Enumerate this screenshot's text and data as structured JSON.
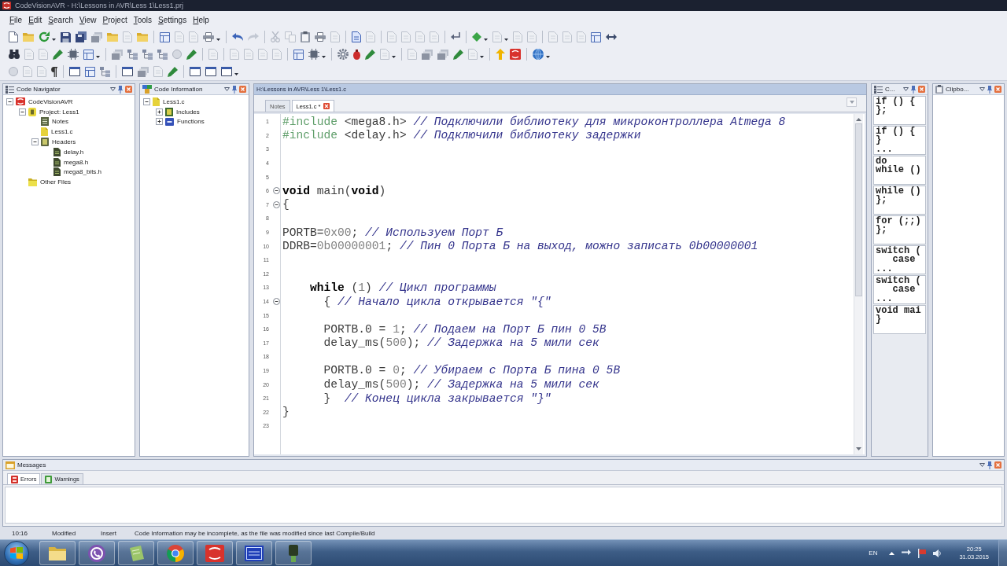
{
  "window": {
    "title": "CodeVisionAVR - H:\\Lessons in AVR\\Less 1\\Less1.prj"
  },
  "menu": [
    "File",
    "Edit",
    "Search",
    "View",
    "Project",
    "Tools",
    "Settings",
    "Help"
  ],
  "code_navigator": {
    "title": "Code Navigator",
    "tree": [
      {
        "label": "CodeVisionAVR",
        "kind": "workspace",
        "expanded": true,
        "children": [
          {
            "label": "Project: Less1",
            "kind": "project",
            "expanded": true,
            "children": [
              {
                "label": "Notes",
                "kind": "notes"
              },
              {
                "label": "Less1.c",
                "kind": "source"
              },
              {
                "label": "Headers",
                "kind": "headers",
                "expanded": true,
                "children": [
                  {
                    "label": "delay.h",
                    "kind": "header"
                  },
                  {
                    "label": "mega8.h",
                    "kind": "header"
                  },
                  {
                    "label": "mega8_bits.h",
                    "kind": "header"
                  }
                ]
              }
            ]
          },
          {
            "label": "Other Files",
            "kind": "folder"
          }
        ]
      }
    ]
  },
  "code_information": {
    "title": "Code Information",
    "tree": [
      {
        "label": "Less1.c",
        "kind": "source",
        "expanded": true,
        "children": [
          {
            "label": "Includes",
            "kind": "includes",
            "expanded": false
          },
          {
            "label": "Functions",
            "kind": "functions",
            "expanded": false
          }
        ]
      }
    ]
  },
  "editor": {
    "path": "H:\\Lessons in AVR\\Less 1\\Less1.c",
    "tabs": [
      {
        "label": "Notes",
        "selected": false,
        "closable": false
      },
      {
        "label": "Less1.c *",
        "selected": true,
        "closable": true
      }
    ],
    "lines": [
      {
        "number": "1",
        "fold": false,
        "segments": [
          {
            "kind": "directive",
            "text": "#include"
          },
          {
            "kind": "plain",
            "text": " <mega8.h> "
          },
          {
            "kind": "comment",
            "text": "// Подключили библиотеку для микроконтроллера Atmega 8"
          }
        ]
      },
      {
        "number": "2",
        "fold": false,
        "segments": [
          {
            "kind": "directive",
            "text": "#include"
          },
          {
            "kind": "plain",
            "text": " <delay.h> "
          },
          {
            "kind": "comment",
            "text": "// Подключили библиотеку задержки"
          }
        ]
      },
      {
        "number": "3",
        "fold": false
      },
      {
        "number": "4",
        "fold": false
      },
      {
        "number": "5",
        "fold": false
      },
      {
        "number": "6",
        "fold": true,
        "segments": [
          {
            "kind": "keyword",
            "text": "void"
          },
          {
            "kind": "plain",
            "text": " main("
          },
          {
            "kind": "keyword",
            "text": "void"
          },
          {
            "kind": "plain",
            "text": ")"
          }
        ]
      },
      {
        "number": "7",
        "fold": true,
        "segments": [
          {
            "kind": "plain",
            "text": "{"
          }
        ]
      },
      {
        "number": "8",
        "fold": false
      },
      {
        "number": "9",
        "fold": false,
        "segments": [
          {
            "kind": "plain",
            "text": "PORTB="
          },
          {
            "kind": "number",
            "text": "0x00"
          },
          {
            "kind": "plain",
            "text": "; "
          },
          {
            "kind": "comment",
            "text": "// Используем Порт Б"
          }
        ]
      },
      {
        "number": "10",
        "fold": false,
        "segments": [
          {
            "kind": "plain",
            "text": "DDRB="
          },
          {
            "kind": "number",
            "text": "0b00000001"
          },
          {
            "kind": "plain",
            "text": "; "
          },
          {
            "kind": "comment",
            "text": "// Пин 0 Порта Б на выход, можно записать 0b00000001"
          }
        ]
      },
      {
        "number": "11",
        "fold": false
      },
      {
        "number": "12",
        "fold": false
      },
      {
        "number": "13",
        "fold": false,
        "segments": [
          {
            "kind": "keyword",
            "text": "    while"
          },
          {
            "kind": "plain",
            "text": " ("
          },
          {
            "kind": "number",
            "text": "1"
          },
          {
            "kind": "plain",
            "text": ") "
          },
          {
            "kind": "comment",
            "text": "// Цикл программы"
          }
        ]
      },
      {
        "number": "14",
        "fold": true,
        "segments": [
          {
            "kind": "plain",
            "text": "      { "
          },
          {
            "kind": "comment",
            "text": "// Начало цикла открывается \"{\""
          }
        ]
      },
      {
        "number": "15",
        "fold": false
      },
      {
        "number": "16",
        "fold": false,
        "segments": [
          {
            "kind": "plain",
            "text": "      PORTB.0 = "
          },
          {
            "kind": "number",
            "text": "1"
          },
          {
            "kind": "plain",
            "text": "; "
          },
          {
            "kind": "comment",
            "text": "// Подаем на Порт Б пин 0 5В"
          }
        ]
      },
      {
        "number": "17",
        "fold": false,
        "segments": [
          {
            "kind": "plain",
            "text": "      delay_ms("
          },
          {
            "kind": "number",
            "text": "500"
          },
          {
            "kind": "plain",
            "text": "); "
          },
          {
            "kind": "comment",
            "text": "// Задержка на 5 мили сек"
          }
        ]
      },
      {
        "number": "18",
        "fold": false
      },
      {
        "number": "19",
        "fold": false,
        "segments": [
          {
            "kind": "plain",
            "text": "      PORTB.0 = "
          },
          {
            "kind": "number",
            "text": "0"
          },
          {
            "kind": "plain",
            "text": "; "
          },
          {
            "kind": "comment",
            "text": "// Убираем с Порта Б пина 0 5В"
          }
        ]
      },
      {
        "number": "20",
        "fold": false,
        "segments": [
          {
            "kind": "plain",
            "text": "      delay_ms("
          },
          {
            "kind": "number",
            "text": "500"
          },
          {
            "kind": "plain",
            "text": "); "
          },
          {
            "kind": "comment",
            "text": "// Задержка на 5 мили сек"
          }
        ]
      },
      {
        "number": "21",
        "fold": false,
        "segments": [
          {
            "kind": "plain",
            "text": "      }  "
          },
          {
            "kind": "comment",
            "text": "// Конец цикла закрывается \"}\""
          }
        ]
      },
      {
        "number": "22",
        "fold": false,
        "segments": [
          {
            "kind": "plain",
            "text": "}"
          }
        ]
      },
      {
        "number": "23",
        "fold": false
      }
    ]
  },
  "code_templates": {
    "title": "C...",
    "items": [
      {
        "lines": [
          "if () {",
          "};"
        ]
      },
      {
        "lines": [
          "if () {",
          "}",
          "..."
        ]
      },
      {
        "lines": [
          "do",
          "while ()"
        ]
      },
      {
        "lines": [
          "while ()",
          "};"
        ]
      },
      {
        "lines": [
          "for (;;)",
          "};"
        ]
      },
      {
        "lines": [
          "switch (",
          "   case",
          "..."
        ]
      },
      {
        "lines": [
          "switch (",
          "   case",
          "..."
        ]
      },
      {
        "lines": [
          "void mai",
          "}"
        ]
      }
    ]
  },
  "clipboard": {
    "title": "Clipbo..."
  },
  "messages": {
    "title": "Messages",
    "tabs": [
      {
        "label": "Errors",
        "kind": "errors",
        "selected": true
      },
      {
        "label": "Warnings",
        "kind": "warnings",
        "selected": false
      }
    ]
  },
  "status_bar": [
    "10:16",
    "Modified",
    "Insert",
    "Code Information may be incomplete, as the file was modified since last Compile/Build"
  ],
  "taskbar": {
    "language": "EN",
    "time": "20:25",
    "date": "31.03.2015"
  }
}
